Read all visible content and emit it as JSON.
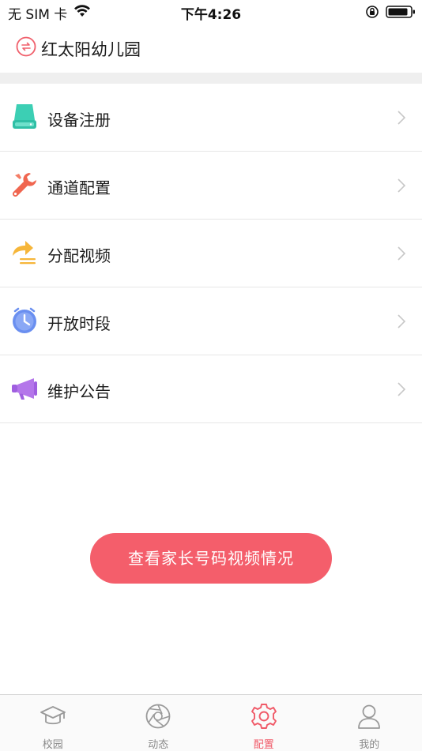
{
  "status_bar": {
    "carrier": "无 SIM 卡",
    "time": "下午4:26"
  },
  "header": {
    "title": "红太阳幼儿园"
  },
  "menu": {
    "items": [
      {
        "label": "设备注册",
        "icon": "server-icon"
      },
      {
        "label": "通道配置",
        "icon": "wrench-icon"
      },
      {
        "label": "分配视频",
        "icon": "share-arrow-icon"
      },
      {
        "label": "开放时段",
        "icon": "clock-icon"
      },
      {
        "label": "维护公告",
        "icon": "megaphone-icon"
      }
    ]
  },
  "cta": {
    "label": "查看家长号码视频情况"
  },
  "tabbar": {
    "items": [
      {
        "label": "校园",
        "icon": "graduation-cap-icon",
        "active": false
      },
      {
        "label": "动态",
        "icon": "aperture-icon",
        "active": false
      },
      {
        "label": "配置",
        "icon": "gear-icon",
        "active": true
      },
      {
        "label": "我的",
        "icon": "person-icon",
        "active": false
      }
    ]
  },
  "colors": {
    "accent": "#f45e6b",
    "active_tab": "#f05a68",
    "inactive_tab": "#8a8a8a"
  }
}
